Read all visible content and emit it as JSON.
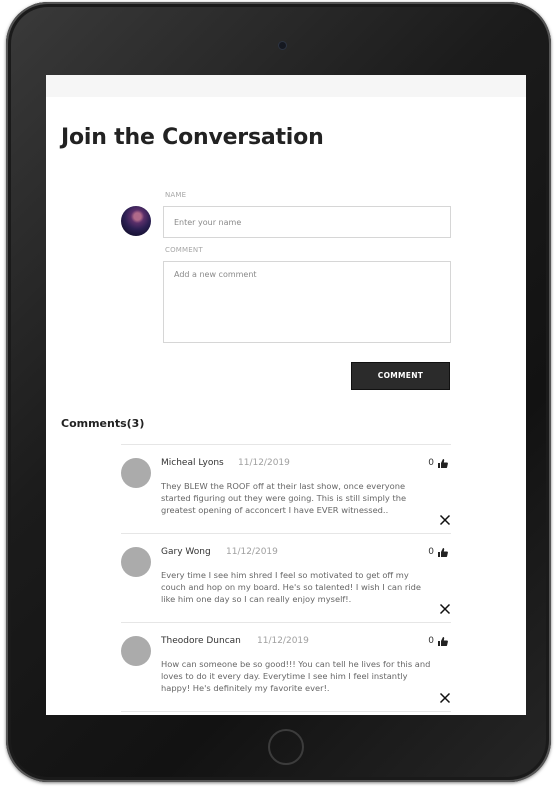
{
  "page": {
    "title": "Join the Conversation"
  },
  "form": {
    "name_label": "NAME",
    "name_placeholder": "Enter your name",
    "comment_label": "COMMENT",
    "comment_placeholder": "Add a new comment",
    "submit_label": "COMMENT"
  },
  "comments_section": {
    "heading": "Comments",
    "count": "(3)"
  },
  "comments": [
    {
      "name": "Micheal Lyons",
      "date": "11/12/2019",
      "likes": "0",
      "text": "They BLEW the ROOF off at their last show, once everyone started figuring out they were going. This is still simply the greatest opening of acconcert I have EVER witnessed.."
    },
    {
      "name": "Gary Wong",
      "date": "11/12/2019",
      "likes": "0",
      "text": "Every time I see him shred I feel so motivated to get off my couch and hop on my board. He's so talented! I wish I can ride like him one day so I can really enjoy myself!."
    },
    {
      "name": "Theodore Duncan",
      "date": "11/12/2019",
      "likes": "0",
      "text": "How can someone be so good!!! You can tell he lives for this and loves to do it every day. Everytime I see him I feel instantly happy! He's definitely my favorite ever!."
    }
  ],
  "icons": {
    "like": "thumbs-up-icon",
    "delete": "close-icon",
    "camera": "camera-icon",
    "home": "home-button"
  }
}
